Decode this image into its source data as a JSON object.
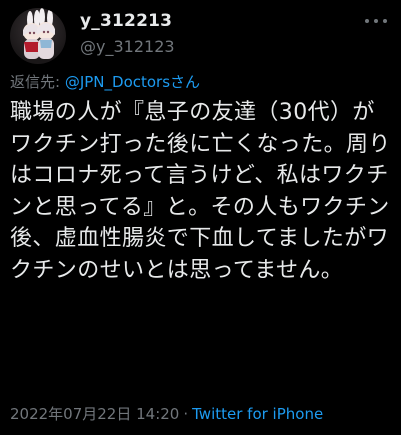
{
  "user": {
    "display_name": "y_312213",
    "handle": "@y_312123",
    "avatar_icon": "anime-character-avatar"
  },
  "reply": {
    "prefix": "返信先: ",
    "mention": "@JPN_Doctorsさん"
  },
  "tweet": {
    "text": "職場の人が『息子の友達（30代）がワクチン打った後に亡くなった。周りはコロナ死って言うけど、私はワクチンと思ってる』と。その人もワクチン後、虚血性腸炎で下血してましたがワクチンのせいとは思ってません。"
  },
  "meta": {
    "timestamp": "2022年07月22日 14:20",
    "separator": "·",
    "source": "Twitter for iPhone"
  },
  "colors": {
    "background": "#000000",
    "text": "#e7e9ea",
    "secondary": "#71767b",
    "link": "#1d9bf0"
  },
  "icons": {
    "more": "more-options-icon"
  }
}
